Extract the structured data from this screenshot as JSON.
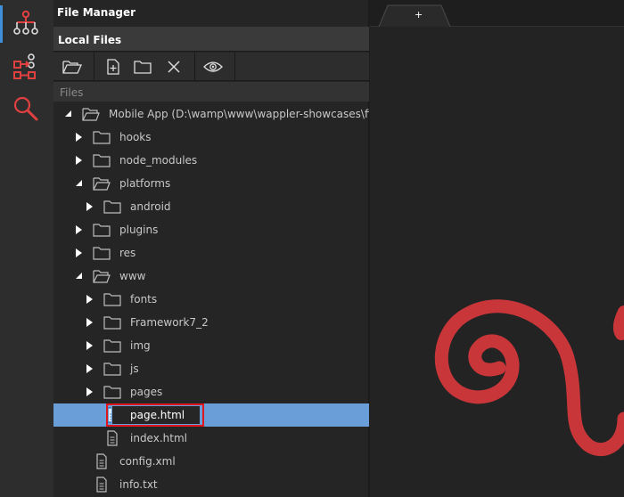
{
  "activity_bar": {
    "items": [
      {
        "icon": "project-structure-icon",
        "active": true
      },
      {
        "icon": "server-connect-icon",
        "active": false
      },
      {
        "icon": "search-icon",
        "active": false
      }
    ]
  },
  "panel": {
    "title": "File Manager",
    "section": "Local Files",
    "files_header": "Files",
    "toolbar": {
      "open_folder": "open-folder-icon",
      "new_file": "new-file-icon",
      "new_folder": "new-folder-icon",
      "delete": "delete-icon",
      "preview": "preview-eye-icon"
    }
  },
  "tree": [
    {
      "label": "Mobile App (D:\\wamp\\www\\wappler-showcases\\fir",
      "type": "folder",
      "state": "open",
      "depth": 0
    },
    {
      "label": "hooks",
      "type": "folder",
      "state": "closed",
      "depth": 1
    },
    {
      "label": "node_modules",
      "type": "folder",
      "state": "closed",
      "depth": 1
    },
    {
      "label": "platforms",
      "type": "folder",
      "state": "open",
      "depth": 1
    },
    {
      "label": "android",
      "type": "folder",
      "state": "closed",
      "depth": 2
    },
    {
      "label": "plugins",
      "type": "folder",
      "state": "closed",
      "depth": 1
    },
    {
      "label": "res",
      "type": "folder",
      "state": "closed",
      "depth": 1
    },
    {
      "label": "www",
      "type": "folder",
      "state": "open",
      "depth": 1
    },
    {
      "label": "fonts",
      "type": "folder",
      "state": "closed",
      "depth": 2
    },
    {
      "label": "Framework7_2",
      "type": "folder",
      "state": "closed",
      "depth": 2
    },
    {
      "label": "img",
      "type": "folder",
      "state": "closed",
      "depth": 2
    },
    {
      "label": "js",
      "type": "folder",
      "state": "closed",
      "depth": 2
    },
    {
      "label": "pages",
      "type": "folder",
      "state": "closed",
      "depth": 2
    },
    {
      "label": "page.html",
      "type": "file",
      "state": "renaming",
      "depth": 2,
      "selected": true
    },
    {
      "label": "index.html",
      "type": "file",
      "state": "none",
      "depth": 2
    },
    {
      "label": "config.xml",
      "type": "file",
      "state": "none",
      "depth": 1
    },
    {
      "label": "info.txt",
      "type": "file",
      "state": "none",
      "depth": 1
    }
  ],
  "editor": {
    "new_tab_label": "+",
    "logo": "wappler-logo"
  },
  "colors": {
    "selection": "#6a9ed8",
    "highlight_box": "#e0161d",
    "logo_red": "#c9363a",
    "accent": "#3e8ed9"
  }
}
